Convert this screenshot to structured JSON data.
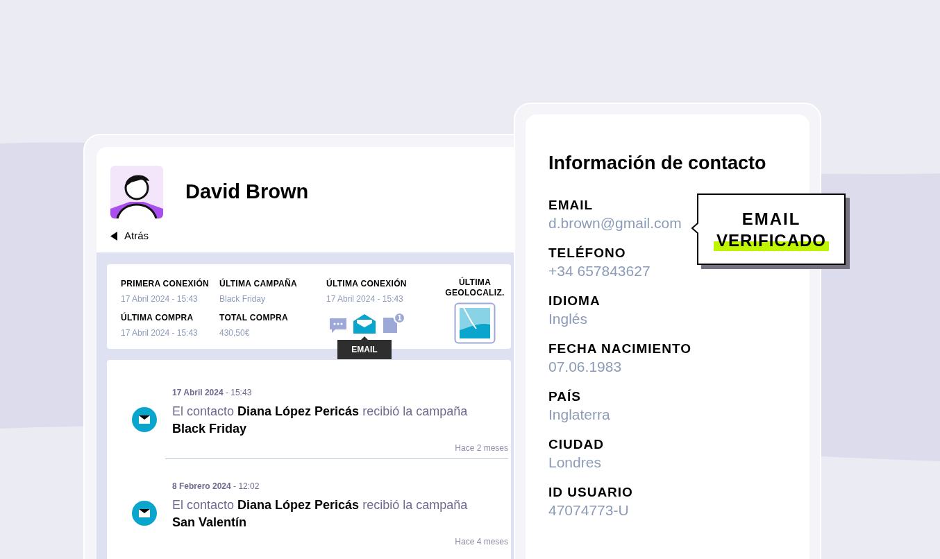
{
  "profile": {
    "name": "David Brown",
    "back_label": "Atrás"
  },
  "stats": [
    {
      "label": "PRIMERA CONEXIÓN",
      "value": "17 Abril 2024 - 15:43"
    },
    {
      "label": "ÚLTIMA CAMPAÑA",
      "value": "Black Friday"
    },
    {
      "label": "ÚLTIMA COMPRA",
      "value": "17 Abril 2024 - 15:43"
    },
    {
      "label": "TOTAL COMPRA",
      "value": "430,50€"
    }
  ],
  "last_connection": {
    "label": "ÚLTIMA CONEXIÓN",
    "value": "17 Abril 2024 - 15:43",
    "tooltip": "EMAIL",
    "channels": [
      {
        "kind": "chat",
        "selected": false
      },
      {
        "kind": "email",
        "selected": true
      },
      {
        "kind": "document",
        "selected": false,
        "badge": "1"
      }
    ]
  },
  "geolocation": {
    "label": "ÚLTIMA GEOLOCALIZ."
  },
  "timeline": [
    {
      "date": "**17 Abril 2024** - 15:43",
      "text": "El contacto **Diana López Pericás** recibió la campaña **Black Friday**",
      "ago": "Hace 2 meses"
    },
    {
      "date": "**8 Febrero 2024** - 12:02",
      "text": "El contacto **Diana López Pericás** recibió la campaña **San Valentín**",
      "ago": "Hace 4 meses"
    }
  ],
  "contact": {
    "title": "Información de contacto",
    "fields": [
      {
        "label": "EMAIL",
        "value": "d.brown@gmail.com"
      },
      {
        "label": "TELÉFONO",
        "value": "+34 657843627"
      },
      {
        "label": "IDIOMA",
        "value": "Inglés"
      },
      {
        "label": "FECHA NACIMIENTO",
        "value": "07.06.1983"
      },
      {
        "label": "PAÍS",
        "value": "Inglaterra"
      },
      {
        "label": "CIUDAD",
        "value": "Londres"
      },
      {
        "label": "ID USUARIO",
        "value": "47074773-U"
      }
    ]
  },
  "callout": {
    "title": "EMAIL",
    "highlight": "VERIFICADO"
  }
}
